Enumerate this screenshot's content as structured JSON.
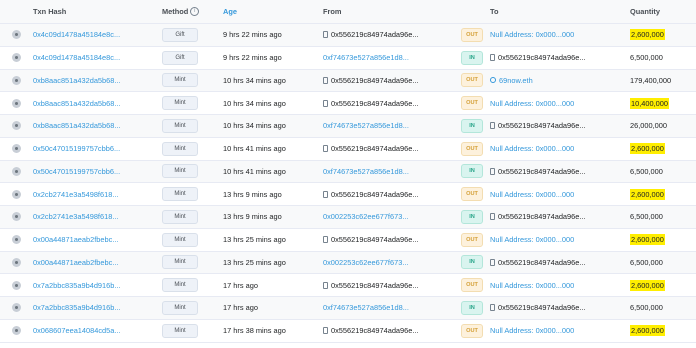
{
  "headers": {
    "txn_hash": "Txn Hash",
    "method": "Method",
    "age": "Age",
    "from": "From",
    "to": "To",
    "quantity": "Quantity"
  },
  "colors": {
    "link": "#3498db",
    "highlight": "#ffee00",
    "out": "#d4a038",
    "in": "#27a488"
  },
  "rows": [
    {
      "hash": "0x4c09d1478a45184e8c...",
      "method": "Gift",
      "age": "9 hrs 22 mins ago",
      "from": "0x556219c84974ada96e...",
      "from_link": false,
      "dir": "OUT",
      "to": "Null Address: 0x000...000",
      "to_type": "null",
      "qty": "2,600,000",
      "highlight": true
    },
    {
      "hash": "0x4c09d1478a45184e8c...",
      "method": "Gift",
      "age": "9 hrs 22 mins ago",
      "from": "0xf74673e527a856e1d8...",
      "from_link": true,
      "dir": "IN",
      "to": "0x556219c84974ada96e...",
      "to_type": "contract",
      "qty": "6,500,000",
      "highlight": false
    },
    {
      "hash": "0xb8aac851a432da5b68...",
      "method": "Mint",
      "age": "10 hrs 34 mins ago",
      "from": "0x556219c84974ada96e...",
      "from_link": false,
      "dir": "OUT",
      "to": "69now.eth",
      "to_type": "ens",
      "qty": "179,400,000",
      "highlight": false
    },
    {
      "hash": "0xb8aac851a432da5b68...",
      "method": "Mint",
      "age": "10 hrs 34 mins ago",
      "from": "0x556219c84974ada96e...",
      "from_link": false,
      "dir": "OUT",
      "to": "Null Address: 0x000...000",
      "to_type": "null",
      "qty": "10,400,000",
      "highlight": true
    },
    {
      "hash": "0xb8aac851a432da5b68...",
      "method": "Mint",
      "age": "10 hrs 34 mins ago",
      "from": "0xf74673e527a856e1d8...",
      "from_link": true,
      "dir": "IN",
      "to": "0x556219c84974ada96e...",
      "to_type": "contract",
      "qty": "26,000,000",
      "highlight": false
    },
    {
      "hash": "0x50c47015199757cbb6...",
      "method": "Mint",
      "age": "10 hrs 41 mins ago",
      "from": "0x556219c84974ada96e...",
      "from_link": false,
      "dir": "OUT",
      "to": "Null Address: 0x000...000",
      "to_type": "null",
      "qty": "2,600,000",
      "highlight": true
    },
    {
      "hash": "0x50c47015199757cbb6...",
      "method": "Mint",
      "age": "10 hrs 41 mins ago",
      "from": "0xf74673e527a856e1d8...",
      "from_link": true,
      "dir": "IN",
      "to": "0x556219c84974ada96e...",
      "to_type": "contract",
      "qty": "6,500,000",
      "highlight": false
    },
    {
      "hash": "0x2cb2741e3a5498f618...",
      "method": "Mint",
      "age": "13 hrs 9 mins ago",
      "from": "0x556219c84974ada96e...",
      "from_link": false,
      "dir": "OUT",
      "to": "Null Address: 0x000...000",
      "to_type": "null",
      "qty": "2,600,000",
      "highlight": true
    },
    {
      "hash": "0x2cb2741e3a5498f618...",
      "method": "Mint",
      "age": "13 hrs 9 mins ago",
      "from": "0x002253c62ee677f673...",
      "from_link": true,
      "dir": "IN",
      "to": "0x556219c84974ada96e...",
      "to_type": "contract",
      "qty": "6,500,000",
      "highlight": false
    },
    {
      "hash": "0x00a44871aeab2fbebc...",
      "method": "Mint",
      "age": "13 hrs 25 mins ago",
      "from": "0x556219c84974ada96e...",
      "from_link": false,
      "dir": "OUT",
      "to": "Null Address: 0x000...000",
      "to_type": "null",
      "qty": "2,600,000",
      "highlight": true
    },
    {
      "hash": "0x00a44871aeab2fbebc...",
      "method": "Mint",
      "age": "13 hrs 25 mins ago",
      "from": "0x002253c62ee677f673...",
      "from_link": true,
      "dir": "IN",
      "to": "0x556219c84974ada96e...",
      "to_type": "contract",
      "qty": "6,500,000",
      "highlight": false
    },
    {
      "hash": "0x7a2bbc835a9b4d916b...",
      "method": "Mint",
      "age": "17 hrs ago",
      "from": "0x556219c84974ada96e...",
      "from_link": false,
      "dir": "OUT",
      "to": "Null Address: 0x000...000",
      "to_type": "null",
      "qty": "2,600,000",
      "highlight": true
    },
    {
      "hash": "0x7a2bbc835a9b4d916b...",
      "method": "Mint",
      "age": "17 hrs ago",
      "from": "0xf74673e527a856e1d8...",
      "from_link": true,
      "dir": "IN",
      "to": "0x556219c84974ada96e...",
      "to_type": "contract",
      "qty": "6,500,000",
      "highlight": false
    },
    {
      "hash": "0x068607eea14084cd5a...",
      "method": "Mint",
      "age": "17 hrs 38 mins ago",
      "from": "0x556219c84974ada96e...",
      "from_link": false,
      "dir": "OUT",
      "to": "Null Address: 0x000...000",
      "to_type": "null",
      "qty": "2,600,000",
      "highlight": true
    }
  ]
}
